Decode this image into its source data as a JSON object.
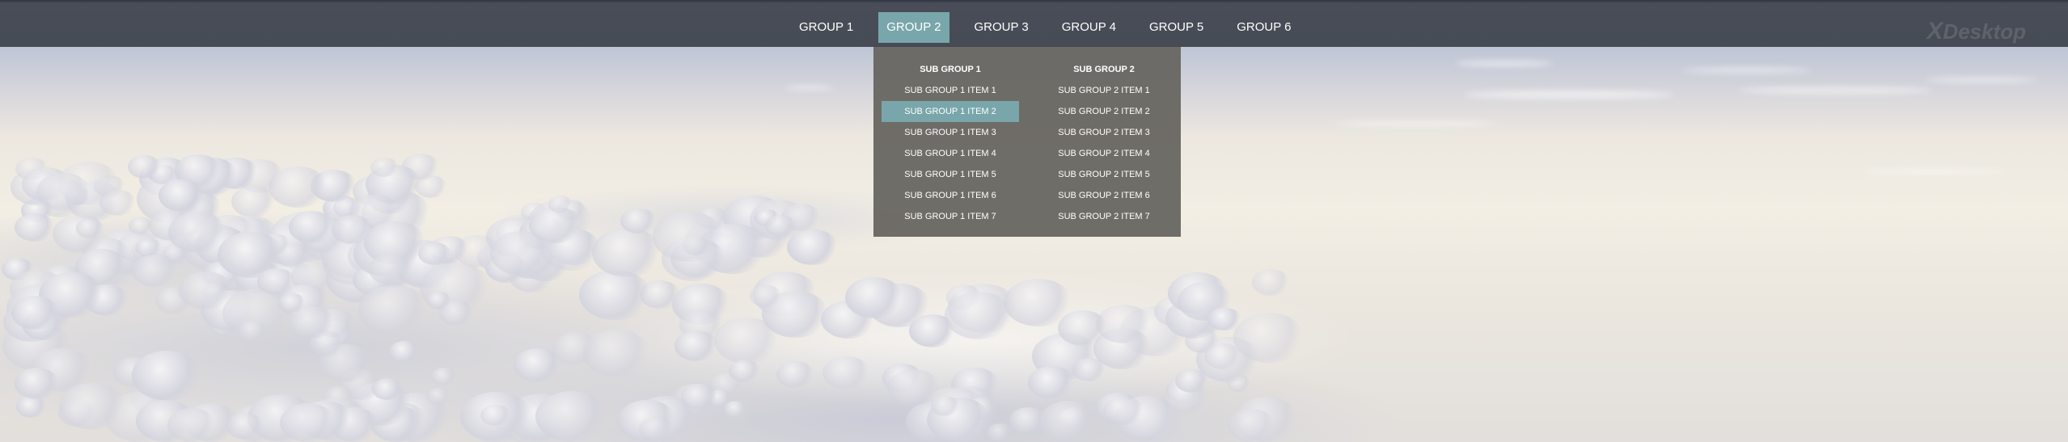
{
  "nav": {
    "items": [
      {
        "label": "GROUP 1"
      },
      {
        "label": "GROUP 2"
      },
      {
        "label": "GROUP 3"
      },
      {
        "label": "GROUP 4"
      },
      {
        "label": "GROUP 5"
      },
      {
        "label": "GROUP 6"
      }
    ],
    "active_index": 1,
    "brand": {
      "x": "X",
      "name": "Desktop"
    }
  },
  "dropdown": {
    "columns": [
      {
        "header": "SUB GROUP 1",
        "items": [
          "SUB GROUP 1 ITEM 1",
          "SUB GROUP 1 ITEM 2",
          "SUB GROUP 1 ITEM 3",
          "SUB GROUP 1 ITEM 4",
          "SUB GROUP 1 ITEM 5",
          "SUB GROUP 1 ITEM 6",
          "SUB GROUP 1 ITEM 7"
        ]
      },
      {
        "header": "SUB GROUP 2",
        "items": [
          "SUB GROUP 2 ITEM 1",
          "SUB GROUP 2 ITEM 2",
          "SUB GROUP 2 ITEM 3",
          "SUB GROUP 2 ITEM 4",
          "SUB GROUP 2 ITEM 5",
          "SUB GROUP 2 ITEM 6",
          "SUB GROUP 2 ITEM 7"
        ]
      }
    ],
    "highlighted": "SUB GROUP 1 ITEM 2"
  },
  "colors": {
    "navbar": "#464b55",
    "accent": "#79a6ab",
    "dropdown": "#696762",
    "text": "#ffffff"
  }
}
